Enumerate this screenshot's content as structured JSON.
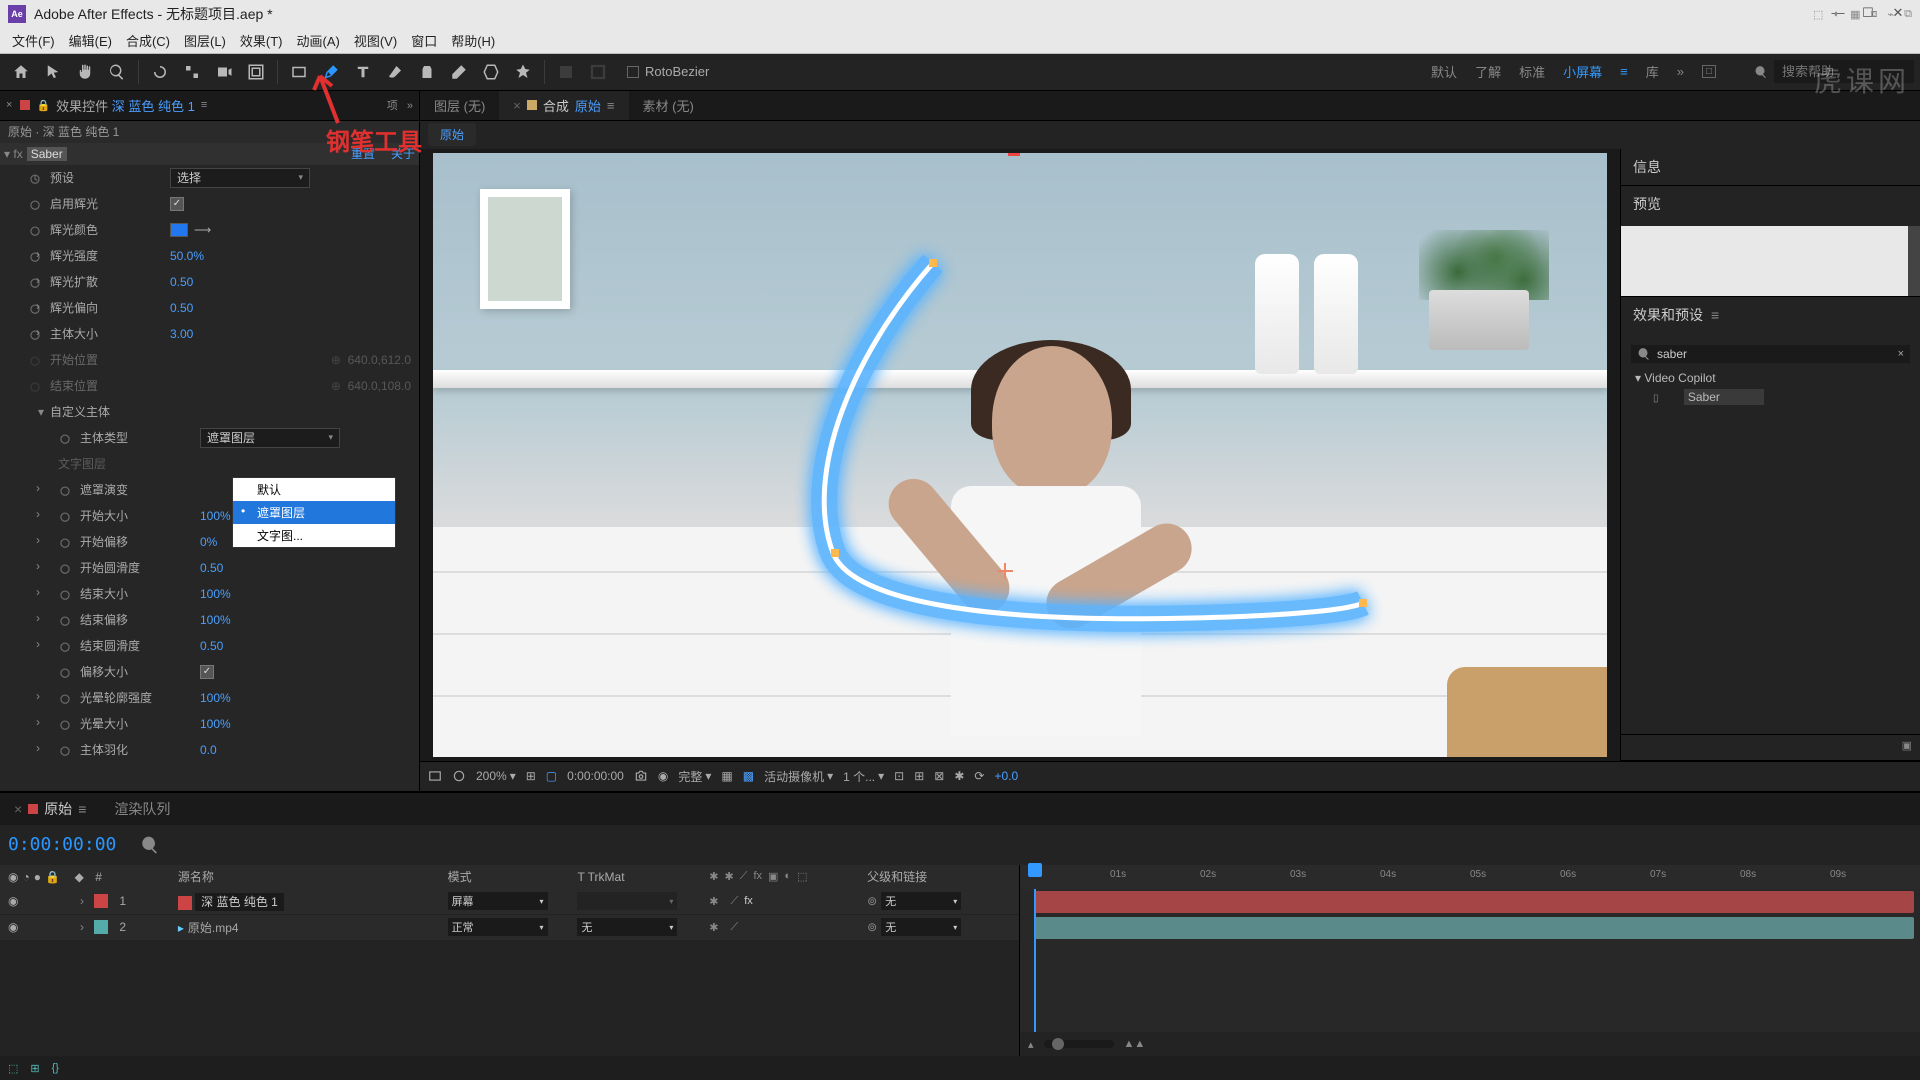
{
  "window": {
    "title": "Adobe After Effects - 无标题项目.aep *"
  },
  "menu": [
    "文件(F)",
    "编辑(E)",
    "合成(C)",
    "图层(L)",
    "效果(T)",
    "动画(A)",
    "视图(V)",
    "窗口",
    "帮助(H)"
  ],
  "toolbar": {
    "rotobezier": "RotoBezier",
    "workspaces": {
      "default": "默认",
      "learn": "了解",
      "standard": "标准",
      "small": "小屏幕",
      "library": "库"
    },
    "search_placeholder": "搜索帮助"
  },
  "annotation": {
    "label": "钢笔工具"
  },
  "effect_panel": {
    "tab_prefix": "效果控件",
    "tab_layer": "深 蓝色 纯色 1",
    "proj_tab": "项",
    "header": "原始 · 深 蓝色 纯色 1",
    "fx_name": "Saber",
    "reset": "重置",
    "about": "关于",
    "props": {
      "preset": {
        "label": "预设",
        "value": "选择"
      },
      "enable_glow": {
        "label": "启用辉光"
      },
      "glow_color": {
        "label": "辉光颜色"
      },
      "glow_intensity": {
        "label": "辉光强度",
        "value": "50.0%"
      },
      "glow_spread": {
        "label": "辉光扩散",
        "value": "0.50"
      },
      "glow_bias": {
        "label": "辉光偏向",
        "value": "0.50"
      },
      "core_size": {
        "label": "主体大小",
        "value": "3.00"
      },
      "start_pos": {
        "label": "开始位置",
        "value": "640.0,612.0"
      },
      "end_pos": {
        "label": "结束位置",
        "value": "640.0,108.0"
      },
      "custom_core": {
        "label": "自定义主体"
      },
      "core_type": {
        "label": "主体类型",
        "value": "遮罩图层"
      },
      "text_layer": {
        "label": "文字图层"
      },
      "mask_evolution": {
        "label": "遮罩演变"
      },
      "start_size": {
        "label": "开始大小",
        "value": "100%"
      },
      "start_offset": {
        "label": "开始偏移",
        "value": "0%"
      },
      "start_round": {
        "label": "开始圆滑度",
        "value": "0.50"
      },
      "end_size": {
        "label": "结束大小",
        "value": "100%"
      },
      "end_offset": {
        "label": "结束偏移",
        "value": "100%"
      },
      "end_round": {
        "label": "结束圆滑度",
        "value": "0.50"
      },
      "offset_size": {
        "label": "偏移大小"
      },
      "halo_intensity": {
        "label": "光晕轮廓强度",
        "value": "100%"
      },
      "halo_size": {
        "label": "光晕大小",
        "value": "100%"
      },
      "core_feather": {
        "label": "主体羽化",
        "value": "0.0"
      }
    },
    "dropdown": {
      "opt1": "默认",
      "opt2": "遮罩图层",
      "opt3": "文字图..."
    }
  },
  "center_tabs": {
    "layer": "图层 (无)",
    "comp_prefix": "合成",
    "comp_name": "原始",
    "footage": "素材 (无)",
    "subtab": "原始"
  },
  "viewer_controls": {
    "zoom": "200%",
    "time": "0:00:00:00",
    "resolution": "完整",
    "camera": "活动摄像机",
    "view_count": "1 个...",
    "exposure": "+0.0"
  },
  "right": {
    "info": "信息",
    "preview": "预览",
    "effects_presets": "效果和预设",
    "search_value": "saber",
    "group": "Video Copilot",
    "item": "Saber"
  },
  "timeline": {
    "tab_main": "原始",
    "tab_render": "渲染队列",
    "timecode": "0:00:00:00",
    "cols": {
      "num": "#",
      "source": "源名称",
      "mode": "模式",
      "trkmat": "T  TrkMat",
      "parent": "父级和链接"
    },
    "layers": [
      {
        "num": "1",
        "name": "深 蓝色 纯色 1",
        "mode": "屏幕",
        "trk": "",
        "parent": "无",
        "color": "#c44"
      },
      {
        "num": "2",
        "name": "原始.mp4",
        "mode": "正常",
        "trk": "无",
        "parent": "无",
        "color": "#5aa"
      }
    ],
    "ruler": [
      "01s",
      "02s",
      "03s",
      "04s",
      "05s",
      "06s",
      "07s",
      "08s",
      "09s"
    ]
  },
  "watermark": "虎课网"
}
